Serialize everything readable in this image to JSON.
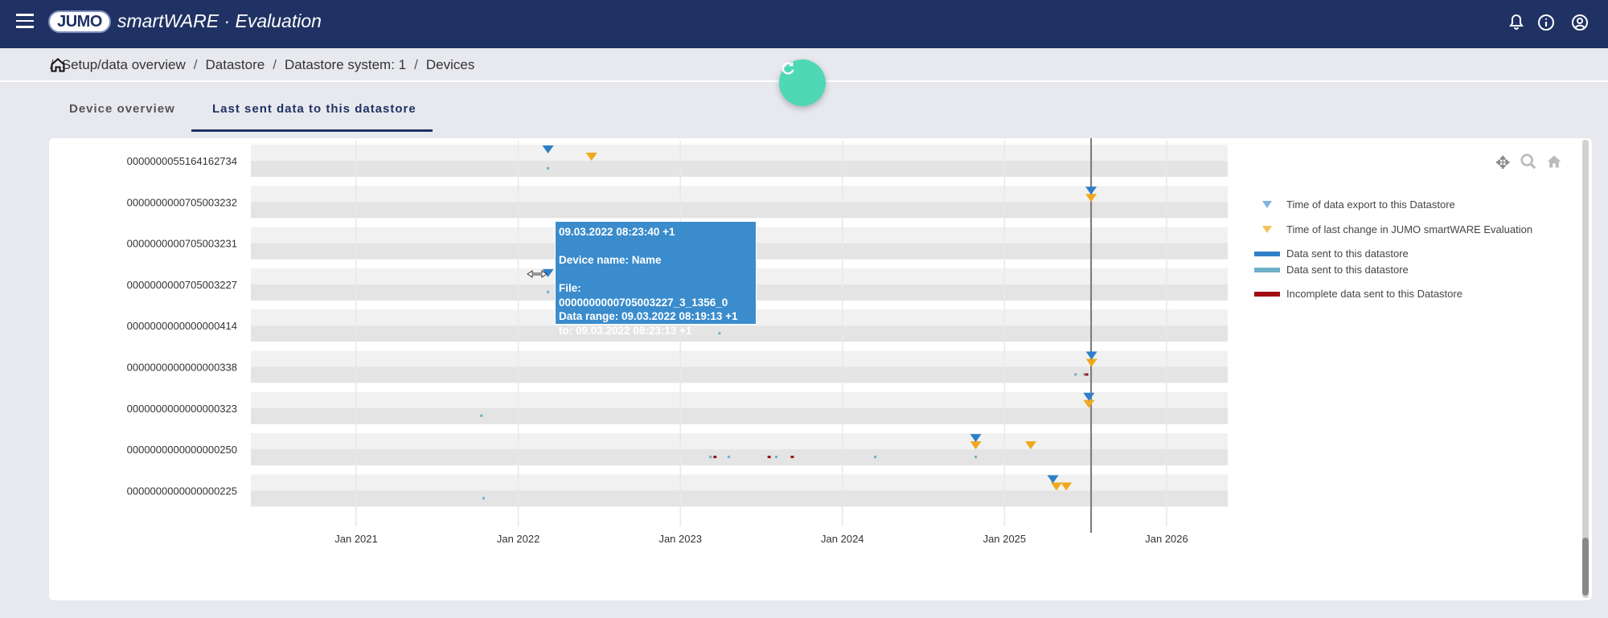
{
  "header": {
    "logo": "JUMO",
    "title": "smartWARE · Evaluation",
    "icons": [
      "menu-icon",
      "bell-icon",
      "info-icon",
      "account-icon"
    ]
  },
  "breadcrumb": {
    "items": [
      "Setup/data overview",
      "Datastore",
      "Datastore system: 1",
      "Devices"
    ],
    "home_icon": "home-icon"
  },
  "refresh_icon": "refresh-icon",
  "tabs": [
    {
      "label": "Device overview",
      "active": false
    },
    {
      "label": "Last sent data to this datastore",
      "active": true
    }
  ],
  "toolbar": {
    "icons": [
      "pan-icon",
      "zoom-icon",
      "reset-home-icon"
    ]
  },
  "tooltip": {
    "time": "09.03.2022 08:23:40 +1",
    "device": "Device name: Name",
    "file": "File: 0000000000705003227_3_1356_0",
    "range": "Data range: 09.03.2022 08:19:13 +1",
    "to": "to: 09.03.2022 08:23:13 +1"
  },
  "legend": [
    {
      "label": "Time of data export to this Datastore",
      "color": "#7fb3e0",
      "shape": "triangle"
    },
    {
      "label": "Time of last change in JUMO smartWARE Evaluation",
      "color": "#f5c15a",
      "shape": "triangle"
    },
    {
      "label": "Data sent to this datastore",
      "color": "#2f7fc8",
      "shape": "bar"
    },
    {
      "label": "Data sent to this datastore",
      "color": "#6fb0c8",
      "shape": "bar"
    },
    {
      "label": "Incomplete data sent to this Datastore",
      "color": "#a00e12",
      "shape": "bar"
    }
  ],
  "chart_data": {
    "type": "scatter",
    "categories": [
      "0000000055164162734",
      "0000000000705003232",
      "0000000000705003231",
      "0000000000705003227",
      "0000000000000000414",
      "0000000000000000338",
      "0000000000000000323",
      "0000000000000000250",
      "0000000000000000225"
    ],
    "x_ticks": [
      "Jan 2021",
      "Jan 2022",
      "Jan 2023",
      "Jan 2024",
      "Jan 2025",
      "Jan 2026"
    ],
    "xlim": [
      "2020-04-15",
      "2026-06-30"
    ],
    "now_line": "2025-07-15",
    "colors": {
      "export": "#2f7fc8",
      "change": "#f0a81c",
      "data": "#6fb0c8",
      "incomplete": "#a00e12"
    },
    "export_times": [
      [
        0,
        "2022-03-09"
      ],
      [
        1,
        "2025-07-15"
      ],
      [
        3,
        "2022-03-09"
      ],
      [
        5,
        "2025-07-16"
      ],
      [
        6,
        "2025-07-10"
      ],
      [
        7,
        "2024-10-28"
      ],
      [
        8,
        "2025-04-20"
      ]
    ],
    "change_times": [
      [
        0,
        "2022-06-15"
      ],
      [
        1,
        "2025-07-15"
      ],
      [
        5,
        "2025-07-16"
      ],
      [
        6,
        "2025-07-10"
      ],
      [
        7,
        "2024-10-28"
      ],
      [
        7,
        "2025-03-01"
      ],
      [
        8,
        "2025-04-28"
      ],
      [
        8,
        "2025-05-20"
      ]
    ],
    "data_sent": [
      [
        0,
        "2022-03-09"
      ],
      [
        3,
        "2022-03-09"
      ],
      [
        4,
        "2023-03-30"
      ],
      [
        6,
        "2021-10-10"
      ],
      [
        7,
        "2023-03-10"
      ],
      [
        7,
        "2023-04-20"
      ],
      [
        7,
        "2023-08-05"
      ],
      [
        7,
        "2024-03-15"
      ],
      [
        7,
        "2024-10-28"
      ],
      [
        5,
        "2025-06-10"
      ],
      [
        5,
        "2025-06-30"
      ],
      [
        8,
        "2021-10-15"
      ]
    ],
    "incomplete": [
      [
        7,
        "2023-03-20"
      ],
      [
        7,
        "2023-07-20"
      ],
      [
        7,
        "2023-09-10"
      ],
      [
        5,
        "2025-07-05"
      ]
    ]
  }
}
